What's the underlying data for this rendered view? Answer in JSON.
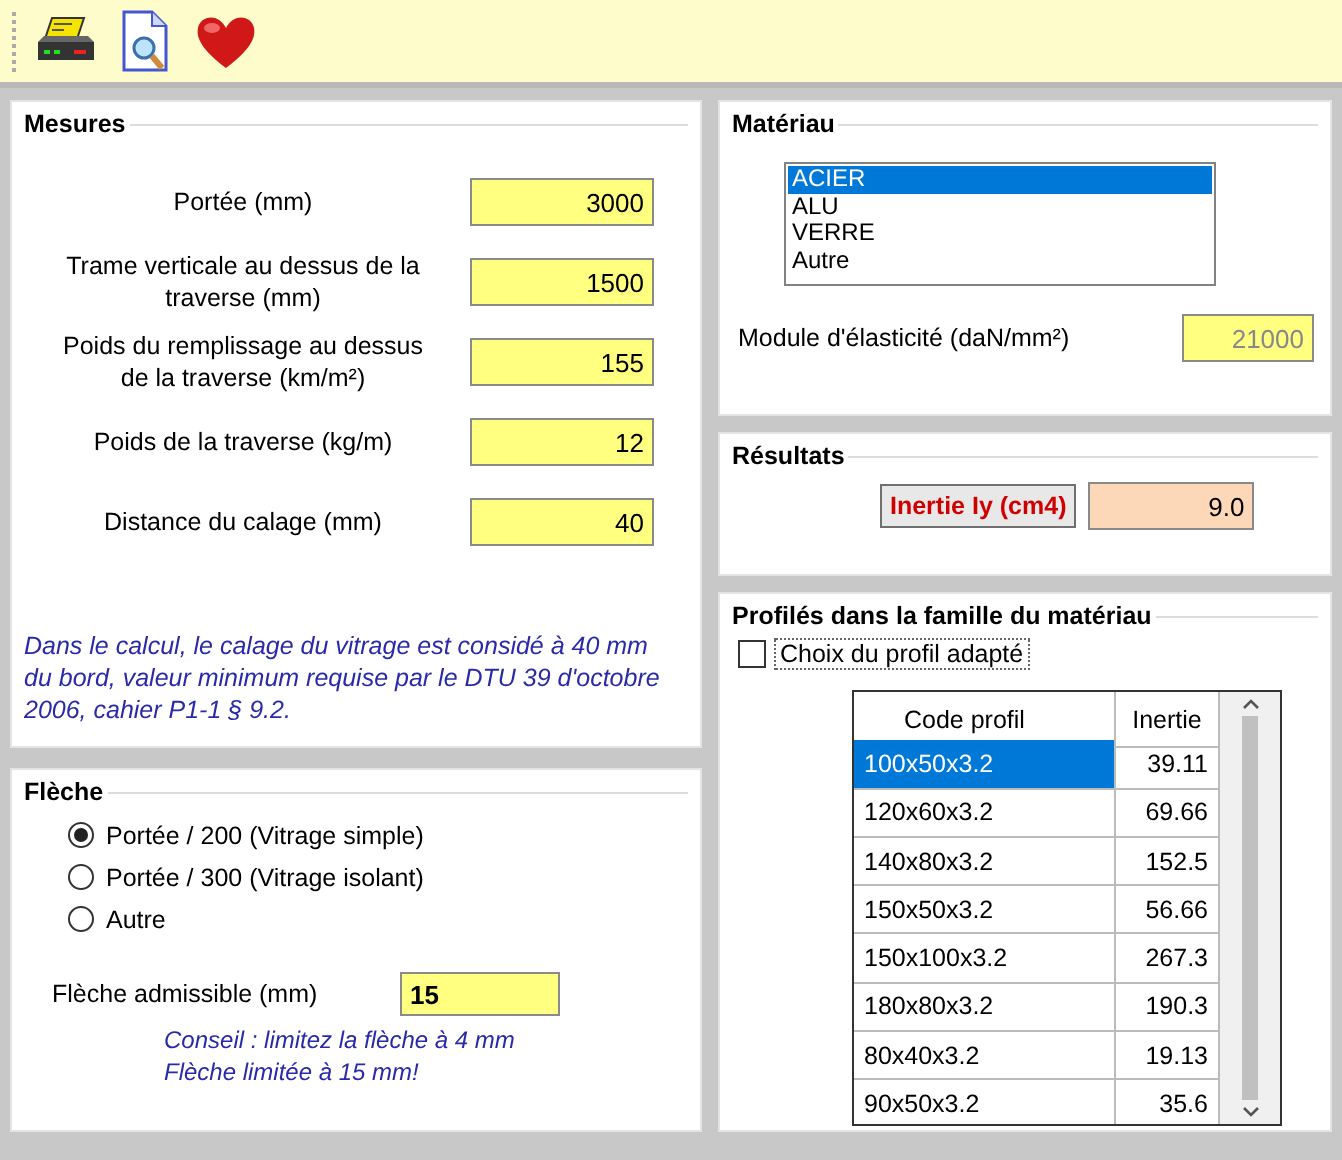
{
  "mesures": {
    "title": "Mesures",
    "fields": [
      {
        "label": "Portée (mm)",
        "value": "3000"
      },
      {
        "label": "Trame verticale au dessus de la traverse (mm)",
        "value": "1500"
      },
      {
        "label": "Poids du remplissage au dessus de la traverse (km/m²)",
        "value": "155"
      },
      {
        "label": "Poids de la traverse (kg/m)",
        "value": "12"
      },
      {
        "label": "Distance du calage (mm)",
        "value": "40"
      }
    ],
    "note": "Dans le calcul, le calage du vitrage est considé à 40 mm du bord, valeur minimum requise par le DTU 39 d'octobre 2006, cahier P1-1 § 9.2."
  },
  "fleche": {
    "title": "Flèche",
    "options": [
      {
        "label": "Portée / 200 (Vitrage simple)",
        "selected": true
      },
      {
        "label": "Portée / 300 (Vitrage isolant)",
        "selected": false
      },
      {
        "label": "Autre",
        "selected": false
      }
    ],
    "field": {
      "label": "Flèche admissible (mm)",
      "value": "15"
    },
    "notes": [
      "Conseil : limitez la flèche à 4 mm",
      "Flèche limitée à 15 mm!"
    ]
  },
  "materiau": {
    "title": "Matériau",
    "list": [
      {
        "label": "ACIER",
        "selected": true
      },
      {
        "label": "ALU",
        "selected": false
      },
      {
        "label": "VERRE",
        "selected": false
      },
      {
        "label": "Autre",
        "selected": false
      }
    ],
    "field": {
      "label": "Module d'élasticité (daN/mm²)",
      "value": "21000",
      "disabled": true
    }
  },
  "resultats": {
    "title": "Résultats",
    "label": "Inertie Iy (cm4)",
    "value": "9.0"
  },
  "profiles": {
    "title": "Profilés dans la famille du matériau",
    "checkbox": {
      "label": "Choix du profil adapté",
      "checked": false
    },
    "table": {
      "columns": [
        "Code profil",
        "Inertie"
      ],
      "rows": [
        {
          "cells": [
            "100x50x3.2",
            "39.11"
          ],
          "selected": true
        },
        {
          "cells": [
            "120x60x3.2",
            "69.66"
          ],
          "selected": false
        },
        {
          "cells": [
            "140x80x3.2",
            "152.5"
          ],
          "selected": false
        },
        {
          "cells": [
            "150x50x3.2",
            "56.66"
          ],
          "selected": false
        },
        {
          "cells": [
            "150x100x3.2",
            "267.3"
          ],
          "selected": false
        },
        {
          "cells": [
            "180x80x3.2",
            "190.3"
          ],
          "selected": false
        },
        {
          "cells": [
            "80x40x3.2",
            "19.13"
          ],
          "selected": false
        },
        {
          "cells": [
            "90x50x3.2",
            "35.6"
          ],
          "selected": false
        }
      ]
    }
  }
}
